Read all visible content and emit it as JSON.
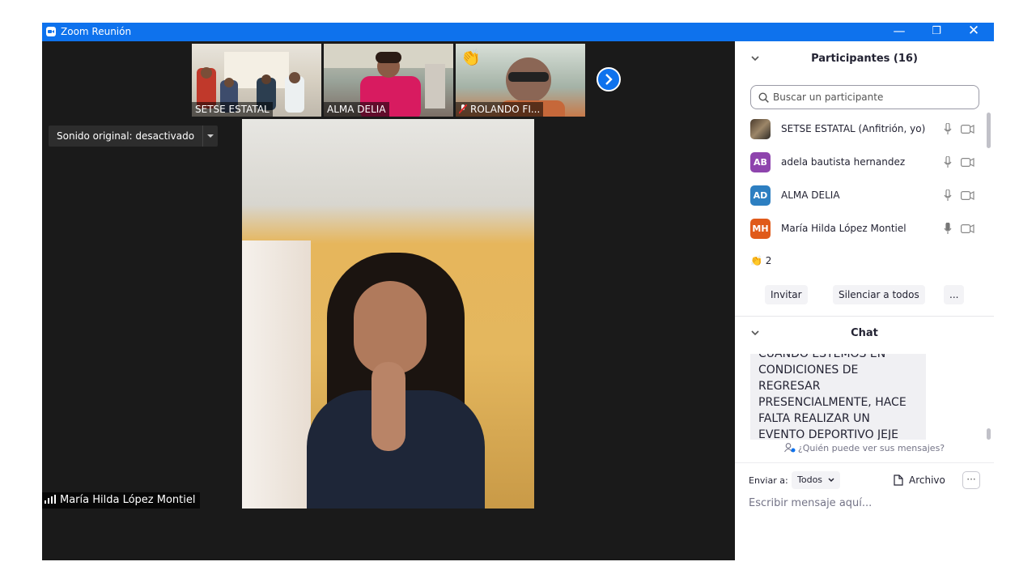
{
  "window": {
    "title": "Zoom Reunión",
    "controls": {
      "minimize": "—",
      "restore": "❐",
      "close": "✕"
    }
  },
  "gallery": {
    "thumbnails": [
      {
        "name": "SETSE ESTATAL"
      },
      {
        "name": "ALMA DELIA"
      },
      {
        "name": "ROLANDO FI..."
      }
    ]
  },
  "audio": {
    "label": "Sonido original: desactivado"
  },
  "speaker": {
    "name": "María Hilda López Montiel"
  },
  "participants": {
    "header": "Participantes (16)",
    "search_placeholder": "Buscar un participante",
    "list": [
      {
        "initials": "",
        "name": "SETSE ESTATAL (Anfitrión, yo)",
        "color": "#6b5a44"
      },
      {
        "initials": "AB",
        "name": "adela bautista hernandez",
        "color": "#8e44ad"
      },
      {
        "initials": "AD",
        "name": "ALMA DELIA",
        "color": "#2d7fc1"
      },
      {
        "initials": "MH",
        "name": "María Hilda López Montiel",
        "color": "#e05a1a"
      }
    ],
    "reaction_count": "2",
    "buttons": {
      "invite": "Invitar",
      "mute_all": "Silenciar a todos",
      "more": "..."
    }
  },
  "chat": {
    "header": "Chat",
    "message": "CUANDO ESTEMOS EN CONDICIONES DE REGRESAR PRESENCIALMENTE, HACE FALTA REALIZAR UN EVENTO DEPORTIVO JEJE",
    "visibility": "¿Quién puede ver sus mensajes?",
    "send_to_label": "Enviar a:",
    "send_to_value": "Todos",
    "file_label": "Archivo",
    "more": "···",
    "input_placeholder": "Escribir mensaje aquí..."
  },
  "colors": {
    "accent": "#0e72ed",
    "stage": "#1a1a1a"
  },
  "icons": [
    "zoom-app-icon",
    "chevron-right-icon",
    "chevron-down-icon",
    "search-icon",
    "microphone-icon",
    "video-camera-icon",
    "clapping-hands-icon",
    "file-icon",
    "signal-icon",
    "muted-mic-icon"
  ]
}
